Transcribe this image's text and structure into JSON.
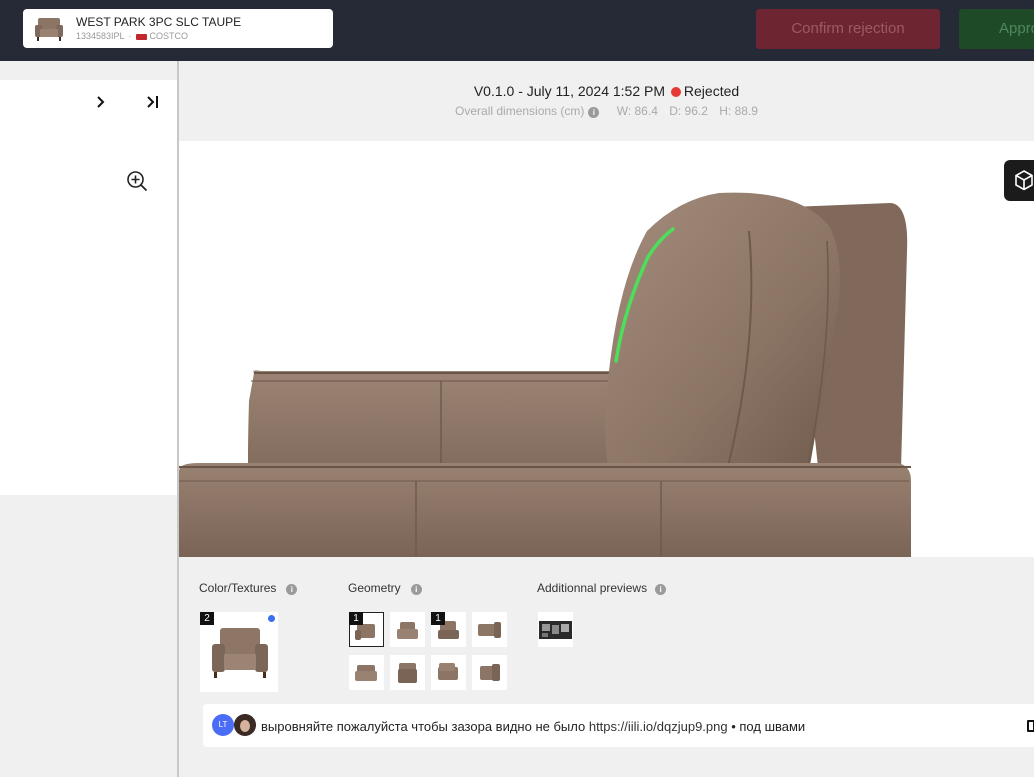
{
  "product": {
    "name": "WEST PARK 3PC SLC TAUPE",
    "sku": "1334583IPL",
    "separator": "·",
    "retailer": "COSTCO"
  },
  "actions": {
    "reject_label": "Confirm rejection",
    "approve_label": "Approve"
  },
  "nav": {
    "next_icon": "chevron-right-icon",
    "last_icon": "skip-to-end-icon"
  },
  "version": {
    "label": "V0.1.0 - July 11, 2024 1:52 PM",
    "status": "Rejected",
    "status_color": "#e53935"
  },
  "dimensions": {
    "label": "Overall dimensions (cm)",
    "w": "W: 86.4",
    "d": "D: 96.2",
    "h": "H: 88.9"
  },
  "sections": {
    "color_textures": "Color/Textures",
    "geometry": "Geometry",
    "additional_previews": "Additionnal previews"
  },
  "color_textures": {
    "badge": "2",
    "has_indicator": true,
    "indicator_color": "#3b6df0"
  },
  "geometry": {
    "items": [
      {
        "badge": "1",
        "selected": true
      },
      {
        "badge": ""
      },
      {
        "badge": "1"
      },
      {
        "badge": ""
      },
      {
        "badge": ""
      },
      {
        "badge": ""
      },
      {
        "badge": ""
      },
      {
        "badge": ""
      }
    ]
  },
  "comment": {
    "avatar_initials": "LT",
    "text": "выровняйте пожалуйста чтобы зазора видно не было",
    "link": "https://iili.io/dqzjup9.png",
    "suffix": "• под швами"
  },
  "colors": {
    "topbar": "#262936",
    "reject_button": "#6c2531",
    "approve_button": "#1e4a28",
    "sofa": "#8c7565",
    "annotation_stroke": "#4ce05a"
  }
}
